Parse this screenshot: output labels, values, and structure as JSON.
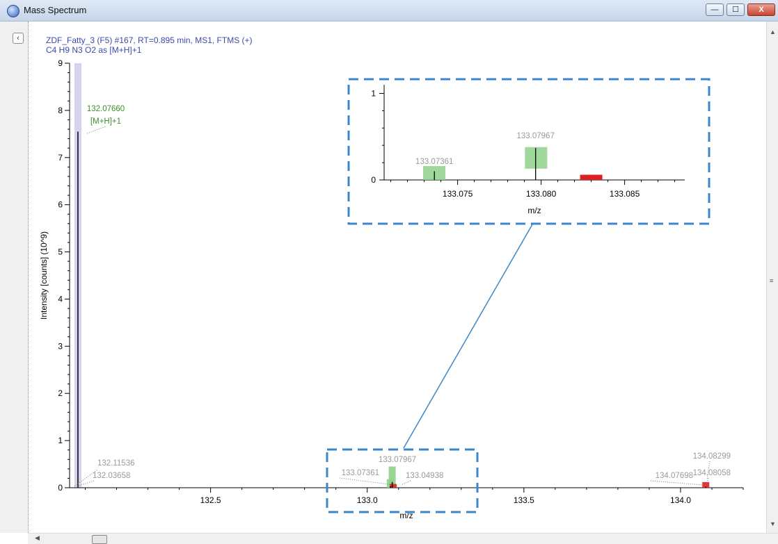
{
  "window": {
    "title": "Mass Spectrum",
    "minimize": "—",
    "maximize": "☐",
    "close": "X"
  },
  "header": {
    "line1": "ZDF_Fatty_3 (F5) #167, RT=0.895 min, MS1, FTMS (+)",
    "line2": "C4 H9 N3 O2 as [M+H]+1"
  },
  "icons": {
    "collapse": "chevron-left-icon",
    "scroll_up": "scroll-up-icon",
    "scroll_down": "scroll-down-icon",
    "scroll_left": "scroll-left-icon"
  },
  "colors": {
    "header_text": "#3b4aa8",
    "label_green": "#3a8f2a",
    "label_gray": "#9a9a9a",
    "match_green": "#8fd08a",
    "mismatch_red": "#e02020",
    "highlight_band": "#d4d4ec",
    "callout_blue": "#3a86c8"
  },
  "chart_data": [
    {
      "type": "scatter",
      "name": "main-spectrum",
      "xlabel": "m/z",
      "ylabel": "Intensity [counts] (10^9)",
      "xlim": [
        132.05,
        134.2
      ],
      "ylim": [
        0,
        9
      ],
      "xticks": [
        "132.5",
        "133.0",
        "133.5",
        "134.0"
      ],
      "yticks": [
        "0",
        "1",
        "2",
        "3",
        "4",
        "5",
        "6",
        "7",
        "8",
        "9"
      ],
      "peaks": [
        {
          "mz": 132.0766,
          "intensity": 7.55
        },
        {
          "mz": 133.07361,
          "intensity": 0.03
        },
        {
          "mz": 133.07967,
          "intensity": 0.12
        },
        {
          "mz": 134.08058,
          "intensity": 0.02
        }
      ],
      "theoretical": [
        {
          "mz": 133.0736,
          "intensity": 0.18,
          "match": true
        },
        {
          "mz": 133.0797,
          "intensity": 0.45,
          "match": true
        },
        {
          "mz": 133.083,
          "intensity": 0.08,
          "match": false
        },
        {
          "mz": 134.0806,
          "intensity": 0.12,
          "match": false
        }
      ],
      "labels": [
        {
          "text": "132.07660",
          "color": "green"
        },
        {
          "text": "[M+H]+1",
          "color": "green"
        },
        {
          "text": "132.11536",
          "color": "gray"
        },
        {
          "text": "132.03658",
          "color": "gray"
        },
        {
          "text": "133.07967",
          "color": "gray"
        },
        {
          "text": "133.07361",
          "color": "gray"
        },
        {
          "text": "133.04938",
          "color": "gray"
        },
        {
          "text": "134.08299",
          "color": "gray"
        },
        {
          "text": "134.07698",
          "color": "gray"
        },
        {
          "text": "134.08058",
          "color": "gray"
        }
      ]
    },
    {
      "type": "scatter",
      "name": "zoom-inset",
      "xlabel": "m/z",
      "xlim": [
        133.0706,
        133.0886
      ],
      "ylim": [
        0,
        1.1
      ],
      "xticks": [
        "133.075",
        "133.080",
        "133.085"
      ],
      "yticks": [
        "0",
        "1"
      ],
      "peaks": [
        {
          "mz": 133.07361,
          "intensity": 0.1
        },
        {
          "mz": 133.07967,
          "intensity": 0.37
        }
      ],
      "theoretical": [
        {
          "mz": 133.0736,
          "intensity": 0.16,
          "match": true
        },
        {
          "mz": 133.0797,
          "intensity": 0.33,
          "match": true
        },
        {
          "mz": 133.083,
          "intensity": 0.06,
          "match": false
        }
      ],
      "labels": [
        {
          "text": "133.07361"
        },
        {
          "text": "133.07967"
        }
      ]
    }
  ]
}
